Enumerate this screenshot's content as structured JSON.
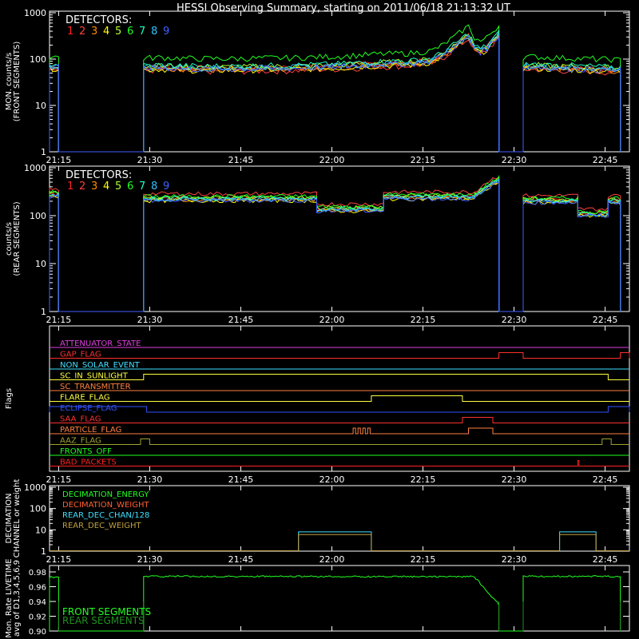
{
  "title": "HESSI Observing Summary, starting on 2011/06/18 21:13:32 UT",
  "x_ticks": [
    "21:15",
    "21:30",
    "21:45",
    "22:00",
    "22:15",
    "22:30",
    "22:45"
  ],
  "x_tick_minutes": [
    1.5,
    16.5,
    31.5,
    46.5,
    61.5,
    76.5,
    91.5
  ],
  "detectors": {
    "label": "DETECTORS:",
    "items": [
      {
        "num": "1",
        "color": "#ff2020"
      },
      {
        "num": "2",
        "color": "#ff4040"
      },
      {
        "num": "3",
        "color": "#ff8c00"
      },
      {
        "num": "4",
        "color": "#ffff00"
      },
      {
        "num": "5",
        "color": "#b0ff30"
      },
      {
        "num": "6",
        "color": "#20ff20"
      },
      {
        "num": "7",
        "color": "#20ffc0"
      },
      {
        "num": "8",
        "color": "#30c0ff"
      },
      {
        "num": "9",
        "color": "#4060ff"
      }
    ]
  },
  "panels": {
    "front": {
      "ylabel1": "MON. counts/s",
      "ylabel2": "(FRONT SEGMENTS)",
      "yticks": [
        "1",
        "10",
        "100",
        "1000"
      ]
    },
    "rear": {
      "ylabel1": "counts/s",
      "ylabel2": "(REAR SEGMENTS)",
      "yticks": [
        "1",
        "10",
        "100",
        "1000"
      ]
    },
    "flags": {
      "ylabel": "Flags"
    },
    "decimation": {
      "ylabel1": "DECIMATION",
      "ylabel2": "CHANNEL or weight",
      "yticks": [
        "1",
        "10",
        "100",
        "1000"
      ]
    },
    "livetime": {
      "ylabel1": "Mon. Rate LIVETIME",
      "ylabel2": "avg of D1,3,4,5,6,9",
      "yticks": [
        "0.90",
        "0.92",
        "0.94",
        "0.96",
        "0.98"
      ]
    }
  },
  "flags": [
    {
      "label": "ATTENUATOR_STATE",
      "color": "#e040e0"
    },
    {
      "label": "GAP_FLAG",
      "color": "#ff3030"
    },
    {
      "label": "NON_SOLAR_EVENT",
      "color": "#40e0ff"
    },
    {
      "label": "SC_IN_SUNLIGHT",
      "color": "#ffff40"
    },
    {
      "label": "SC_TRANSMITTER",
      "color": "#ff8040"
    },
    {
      "label": "FLARE_FLAG",
      "color": "#ffff40"
    },
    {
      "label": "ECLIPSE_FLAG",
      "color": "#3050ff"
    },
    {
      "label": "SAA_FLAG",
      "color": "#ff3030"
    },
    {
      "label": "PARTICLE_FLAG",
      "color": "#ff8040"
    },
    {
      "label": "AAZ_FLAG",
      "color": "#a0a030"
    },
    {
      "label": "FRONTS_OFF",
      "color": "#20ff20"
    },
    {
      "label": "BAD_PACKETS",
      "color": "#ff2020"
    }
  ],
  "decimation_legend": [
    {
      "label": "DECIMATION_ENERGY",
      "color": "#20ff20"
    },
    {
      "label": "DECIMATION_WEIGHT",
      "color": "#ff6030"
    },
    {
      "label": "REAR_DEC_CHAN/128",
      "color": "#40e0ff"
    },
    {
      "label": "REAR_DEC_WEIGHT",
      "color": "#c0a040"
    }
  ],
  "livetime_legend": [
    {
      "label": "FRONT SEGMENTS",
      "color": "#20ff20"
    },
    {
      "label": "REAR SEGMENTS",
      "color": "#209020"
    }
  ],
  "chart_data": [
    {
      "type": "line",
      "panel": "front",
      "xlabel": "",
      "ylabel": "MON. counts/s (FRONT SEGMENTS)",
      "x_range_minutes": [
        0,
        95.5
      ],
      "ylim": [
        1,
        1000
      ],
      "yscale": "log",
      "data_intervals": [
        [
          0,
          1.5
        ],
        [
          15.5,
          74
        ],
        [
          78,
          94
        ]
      ],
      "baseline_minutes": [
        0,
        3,
        6,
        9,
        12,
        15,
        18,
        21,
        24,
        27,
        30,
        33,
        36,
        39,
        42,
        45,
        48,
        51,
        54,
        57,
        60,
        63,
        65,
        67,
        69,
        70,
        71,
        72,
        73,
        74
      ],
      "baseline_values": [
        60,
        60,
        60,
        60,
        60,
        65,
        68,
        66,
        64,
        64,
        64,
        65,
        66,
        66,
        68,
        70,
        72,
        76,
        80,
        82,
        85,
        95,
        130,
        200,
        320,
        180,
        150,
        180,
        250,
        330
      ],
      "after_gap_values": [
        70,
        68,
        66,
        64,
        62,
        60
      ],
      "series_offsets": [
        {
          "detector": "1",
          "factor": 1.0
        },
        {
          "detector": "2",
          "factor": 0.85
        },
        {
          "detector": "3",
          "factor": 0.95
        },
        {
          "detector": "4",
          "factor": 0.9
        },
        {
          "detector": "5",
          "factor": 1.05
        },
        {
          "detector": "6",
          "factor": 1.6
        },
        {
          "detector": "7",
          "factor": 1.1
        },
        {
          "detector": "8",
          "factor": 1.0
        },
        {
          "detector": "9",
          "factor": 0.95
        }
      ]
    },
    {
      "type": "line",
      "panel": "rear",
      "ylabel": "counts/s (REAR SEGMENTS)",
      "x_range_minutes": [
        0,
        95.5
      ],
      "ylim": [
        1,
        1000
      ],
      "yscale": "log",
      "data_intervals": [
        [
          0,
          1.5
        ],
        [
          15.5,
          74
        ],
        [
          78,
          94
        ]
      ],
      "segments": [
        {
          "from": 15.5,
          "to": 44,
          "value": 230
        },
        {
          "from": 44,
          "to": 55,
          "value": 140
        },
        {
          "from": 55,
          "to": 70,
          "value": 250
        },
        {
          "from": 70,
          "to": 74,
          "value": 450
        },
        {
          "from": 78,
          "to": 87,
          "value": 210
        },
        {
          "from": 87,
          "to": 92,
          "value": 110
        },
        {
          "from": 92,
          "to": 94,
          "value": 210
        }
      ]
    },
    {
      "type": "step",
      "panel": "flags",
      "events": [
        {
          "flag": "GAP_FLAG",
          "high": [
            [
              74,
              78
            ],
            [
              94,
              95.5
            ]
          ]
        },
        {
          "flag": "SC_IN_SUNLIGHT",
          "high": [
            [
              15.5,
              92
            ]
          ]
        },
        {
          "flag": "FLARE_FLAG",
          "high": [
            [
              53,
              68
            ]
          ]
        },
        {
          "flag": "ECLIPSE_FLAG",
          "high": [
            [
              0,
              16
            ],
            [
              92,
              95.5
            ]
          ]
        },
        {
          "flag": "SAA_FLAG",
          "high": [
            [
              68,
              73
            ]
          ]
        },
        {
          "flag": "PARTICLE_FLAG",
          "high": [
            [
              50,
              50.4
            ],
            [
              50.8,
              51.2
            ],
            [
              51.6,
              52
            ],
            [
              52.4,
              52.8
            ],
            [
              69,
              73
            ]
          ]
        },
        {
          "flag": "AAZ_FLAG",
          "high": [
            [
              15,
              16.5
            ],
            [
              91,
              92.5
            ]
          ]
        },
        {
          "flag": "BAD_PACKETS",
          "high": [
            [
              87,
              87.2
            ]
          ]
        }
      ]
    },
    {
      "type": "step",
      "panel": "decimation",
      "ylim": [
        1,
        1000
      ],
      "yscale": "log",
      "series": [
        {
          "name": "REAR_DEC_CHAN/128",
          "high": [
            [
              41,
              53
            ],
            [
              84,
              90
            ]
          ],
          "value": 8
        },
        {
          "name": "REAR_DEC_WEIGHT",
          "high": [
            [
              41,
              53
            ],
            [
              84,
              90
            ]
          ],
          "value": 6
        }
      ]
    },
    {
      "type": "line",
      "panel": "livetime",
      "ylim": [
        0.9,
        0.98
      ],
      "intervals": [
        [
          0,
          1.5
        ],
        [
          15.5,
          74
        ],
        [
          78,
          94
        ]
      ],
      "front_level": 0.975,
      "end_drop_to": 0.937
    }
  ]
}
